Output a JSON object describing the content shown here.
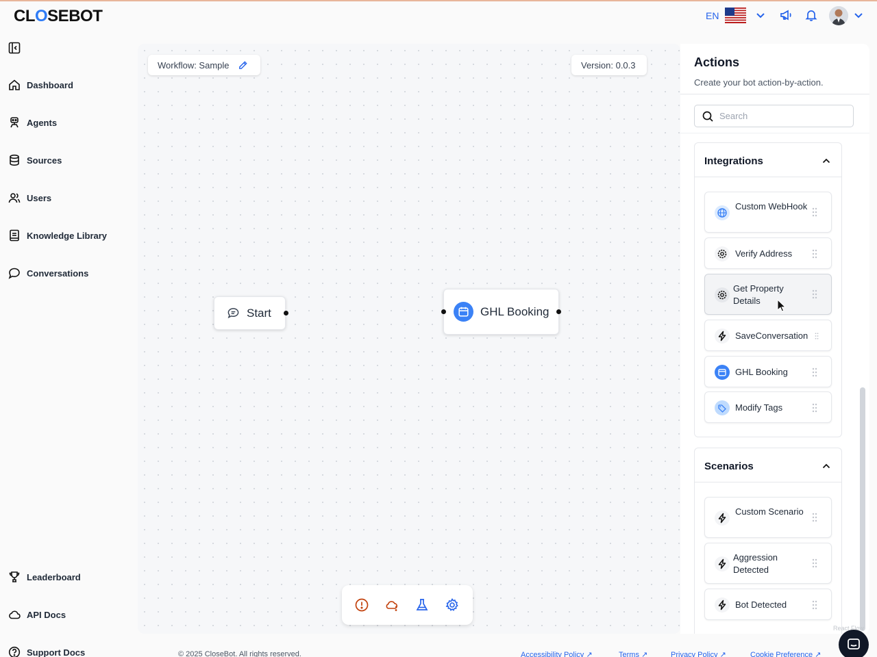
{
  "brand": {
    "logo_pre": "CL",
    "logo_o": "O",
    "logo_post": "SEBOT"
  },
  "header": {
    "language": "EN"
  },
  "sidebar": {
    "items": [
      {
        "label": "Dashboard",
        "icon": "home-icon"
      },
      {
        "label": "Agents",
        "icon": "agent-icon"
      },
      {
        "label": "Sources",
        "icon": "database-icon"
      },
      {
        "label": "Users",
        "icon": "users-icon"
      },
      {
        "label": "Knowledge Library",
        "icon": "book-icon"
      },
      {
        "label": "Conversations",
        "icon": "chat-icon"
      }
    ],
    "bottom_items": [
      {
        "label": "Leaderboard",
        "icon": "trophy-icon"
      },
      {
        "label": "API Docs",
        "icon": "cloud-icon"
      },
      {
        "label": "Support Docs",
        "icon": "help-icon"
      }
    ]
  },
  "canvas": {
    "workflow_label": "Workflow: Sample",
    "version_label": "Version: 0.0.3",
    "nodes": {
      "start": "Start",
      "ghl_booking": "GHL Booking"
    }
  },
  "actions": {
    "title": "Actions",
    "subtitle": "Create your bot action-by-action.",
    "search_placeholder": "Search",
    "sections": [
      {
        "title": "Integrations",
        "items": [
          {
            "label": "Custom WebHook",
            "icon": "globe-icon"
          },
          {
            "label": "Verify Address",
            "icon": "gear-icon"
          },
          {
            "label": "Get Property Details",
            "icon": "gear-icon"
          },
          {
            "label": "SaveConversation",
            "icon": "bolt-icon"
          },
          {
            "label": "GHL Booking",
            "icon": "calendar-icon"
          },
          {
            "label": "Modify Tags",
            "icon": "tag-icon"
          }
        ]
      },
      {
        "title": "Scenarios",
        "items": [
          {
            "label": "Custom Scenario",
            "icon": "bolt-icon"
          },
          {
            "label": "Aggression Detected",
            "icon": "bolt-icon"
          },
          {
            "label": "Bot Detected",
            "icon": "bolt-icon"
          }
        ]
      }
    ]
  },
  "watermark": "React Flow",
  "footer": {
    "copyright": "© 2025 CloseBot. All rights reserved.",
    "links": [
      "Accessibility Policy",
      "Terms",
      "Privacy Policy",
      "Cookie Preference"
    ]
  },
  "colors": {
    "accent": "#2f7cf6",
    "link": "#2563eb",
    "warning": "#c2410c"
  }
}
